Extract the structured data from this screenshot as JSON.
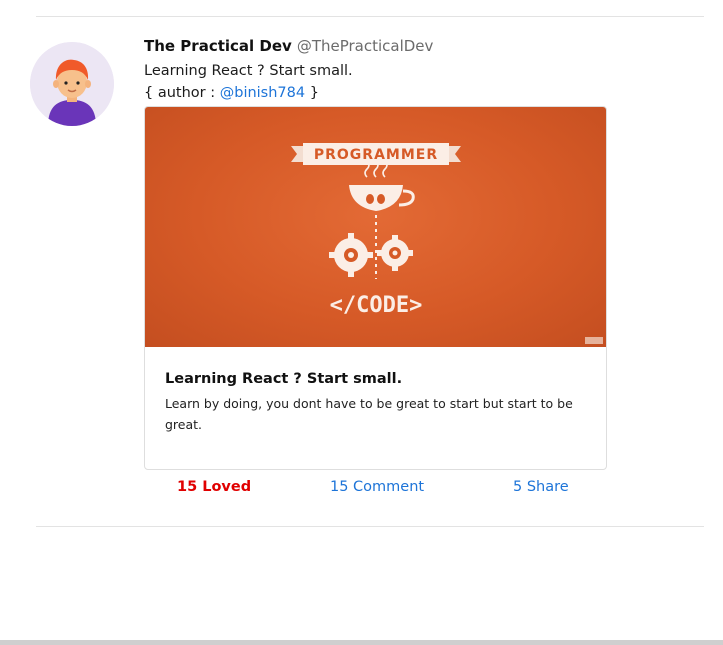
{
  "tweet": {
    "author_name": "The Practical Dev",
    "author_handle": "@ThePracticalDev",
    "text": "Learning React ? Start small.",
    "credit_prefix": "{ author : ",
    "credit_mention": "@binish784",
    "credit_suffix": " }"
  },
  "card": {
    "image_top_label": "PROGRAMMER",
    "image_bottom_label": "</CODE>",
    "title": "Learning React ? Start small.",
    "description": "Learn by doing, you dont have to be great to start but start to be great."
  },
  "actions": {
    "loved": "15 Loved",
    "comment": "15 Comment",
    "share": "5 Share"
  },
  "colors": {
    "accent_red": "#e00000",
    "link_blue": "#1d74d8",
    "image_orange": "#d65a27"
  },
  "icons": [
    "avatar",
    "coffee-cup-icon",
    "gears-icon"
  ]
}
